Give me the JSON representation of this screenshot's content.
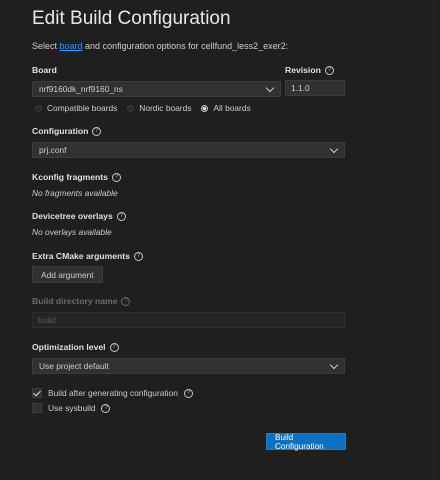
{
  "title": "Edit Build Configuration",
  "subtitle": {
    "prefix": "Select ",
    "link": "board",
    "suffix": " and configuration options for cellfund_less2_exer2:"
  },
  "board": {
    "label": "Board",
    "value": "nrf9160dk_nrf9160_ns",
    "radio_options": [
      "Compatible boards",
      "Nordic boards",
      "All boards"
    ],
    "selected_option": "All boards"
  },
  "revision": {
    "label": "Revision",
    "value": "1.1.0"
  },
  "configuration": {
    "label": "Configuration",
    "value": "prj.conf"
  },
  "kconfig": {
    "label": "Kconfig fragments",
    "empty_text": "No fragments available"
  },
  "devicetree": {
    "label": "Devicetree overlays",
    "empty_text": "No overlays available"
  },
  "cmake": {
    "label": "Extra CMake arguments",
    "button": "Add argument"
  },
  "build_dir": {
    "label": "Build directory name",
    "placeholder": "build"
  },
  "optimization": {
    "label": "Optimization level",
    "value": "Use project default"
  },
  "options": {
    "build_after": {
      "label": "Build after generating configuration",
      "checked": true
    },
    "sysbuild": {
      "label": "Use sysbuild",
      "checked": false
    }
  },
  "submit_button": "Build Configuration",
  "help_icon_glyph": "?",
  "colors": {
    "accent": "#0e70c0",
    "link": "#3794ff",
    "background": "#1f1f1f",
    "input": "#313131"
  }
}
